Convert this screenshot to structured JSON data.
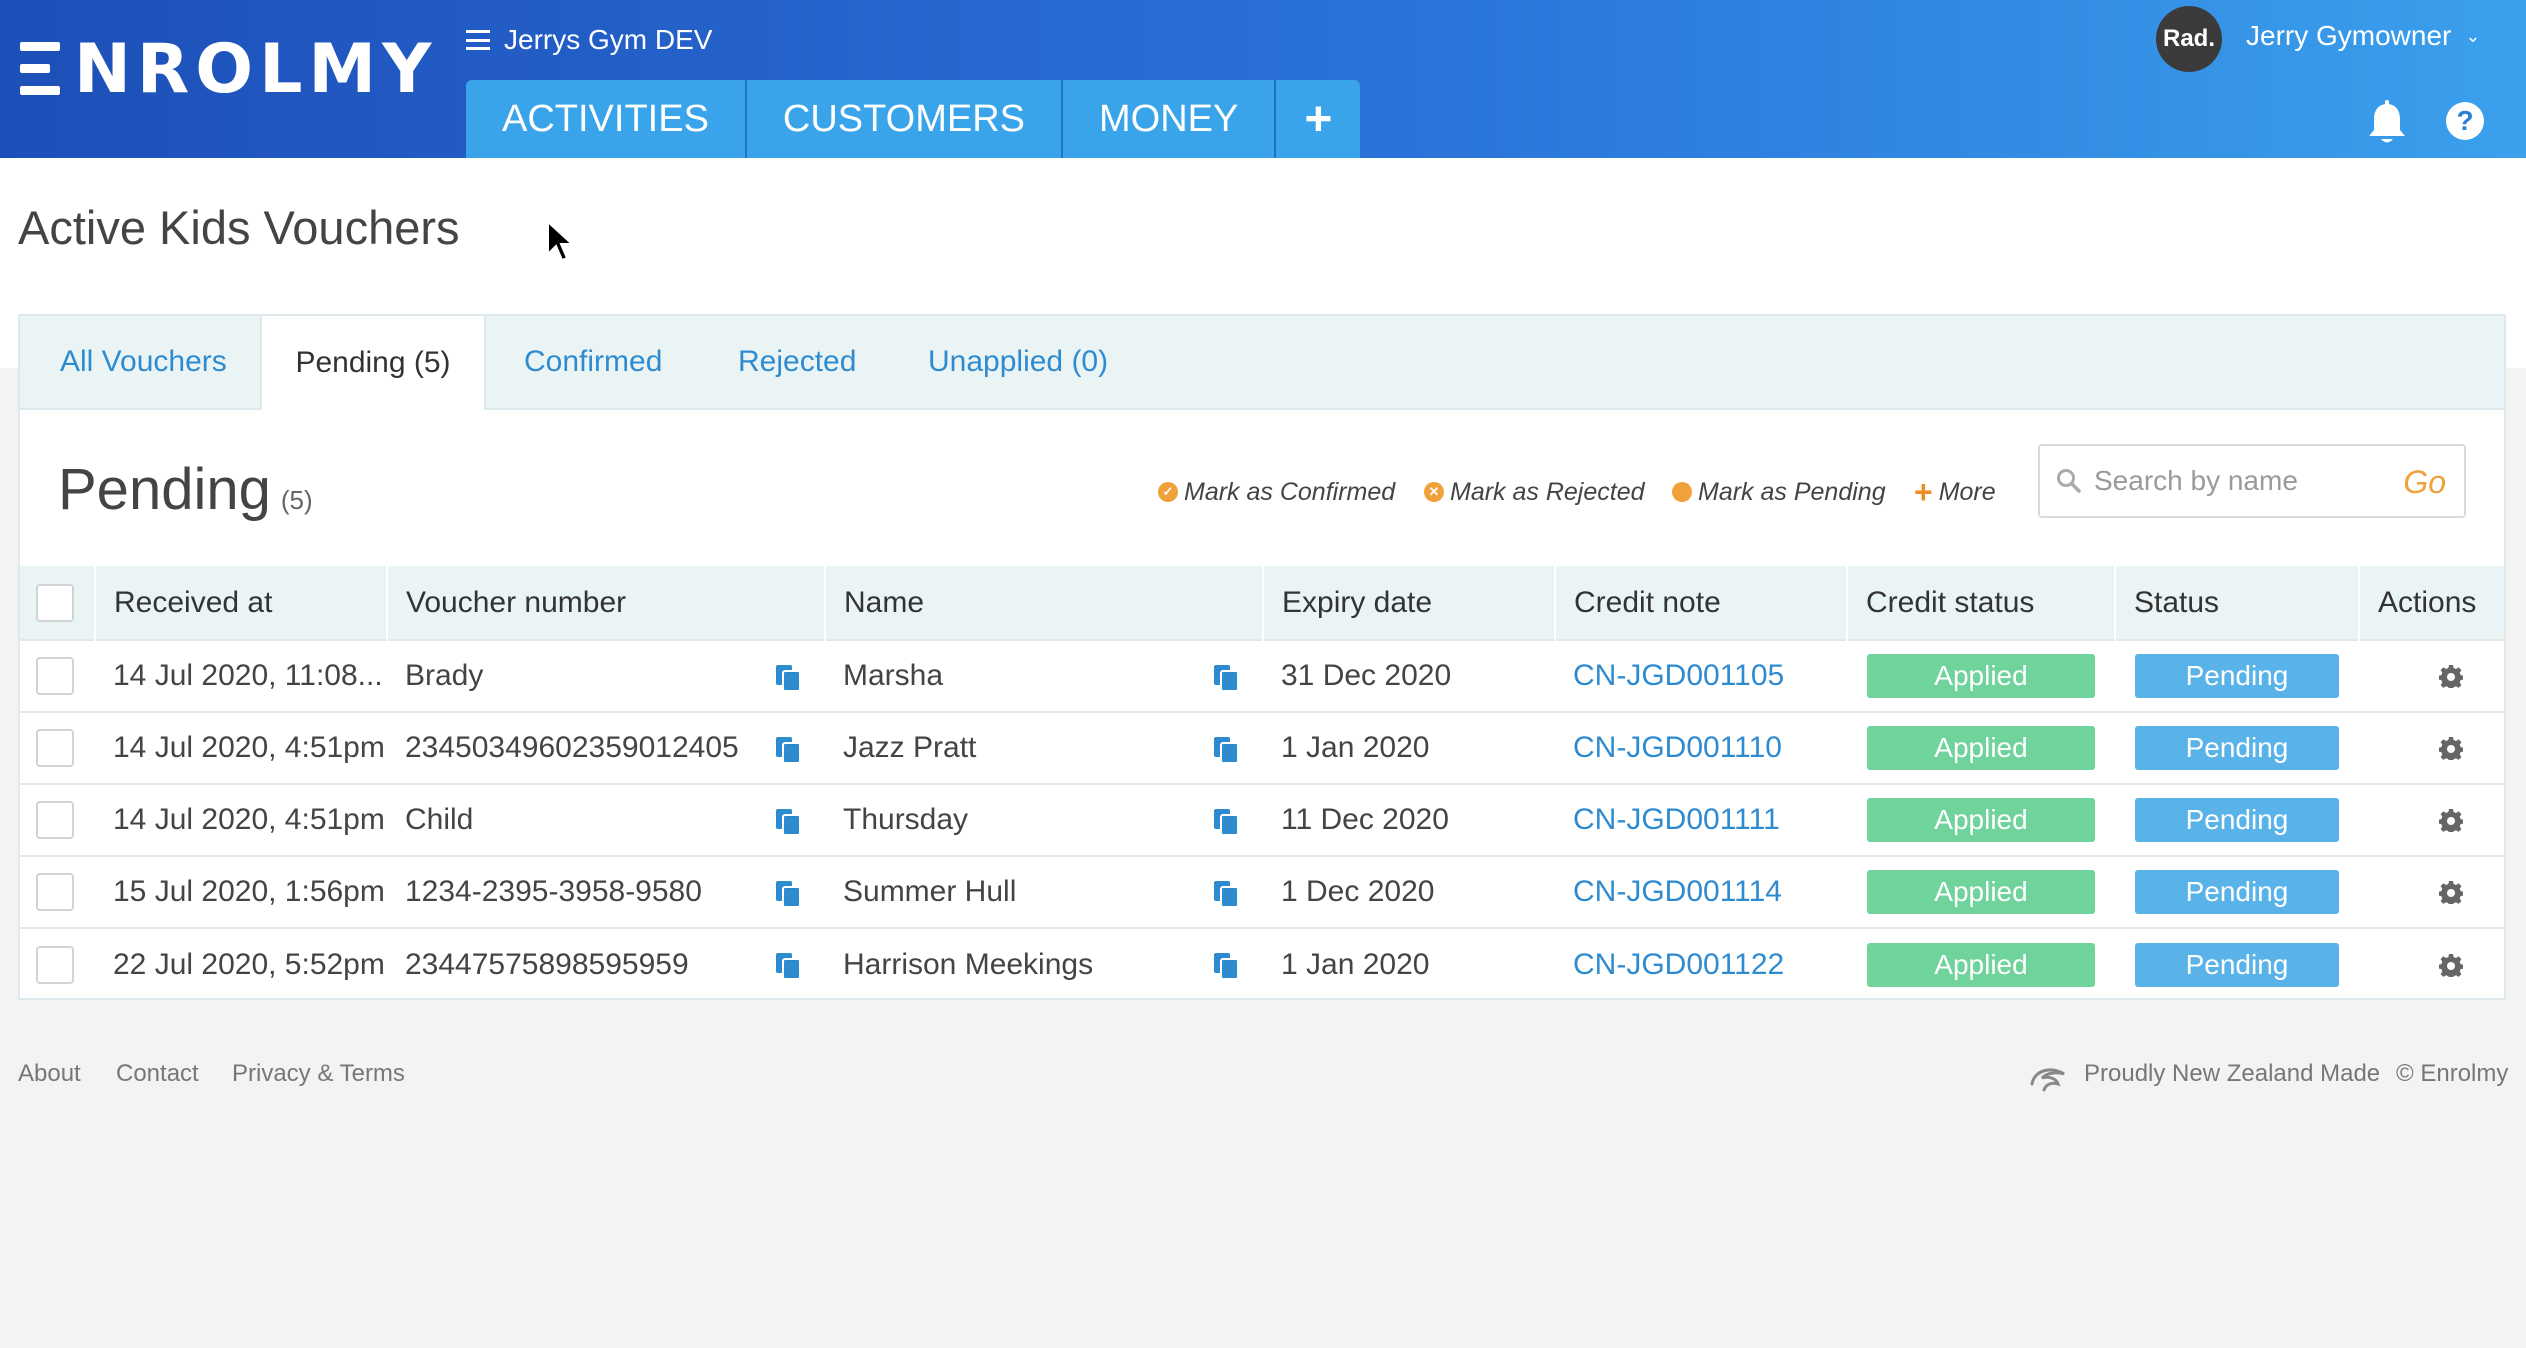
{
  "header": {
    "logo_text": "NROLMY",
    "gym_name": "Jerrys Gym DEV",
    "nav_tabs": [
      "ACTIVITIES",
      "CUSTOMERS",
      "MONEY"
    ],
    "plus_label": "+",
    "avatar_text": "Rad.",
    "user_name": "Jerry Gymowner",
    "help_label": "?"
  },
  "page": {
    "title": "Active Kids Vouchers"
  },
  "tabs": [
    "All Vouchers",
    "Pending (5)",
    "Confirmed",
    "Rejected",
    "Unapplied (0)"
  ],
  "section": {
    "title": "Pending",
    "count": "(5)"
  },
  "actions": {
    "confirm": "Mark as Confirmed",
    "reject": "Mark as Rejected",
    "pending": "Mark as Pending",
    "more": "More"
  },
  "search": {
    "placeholder": "Search by name",
    "go": "Go"
  },
  "table": {
    "headers": [
      "Received at",
      "Voucher number",
      "Name",
      "Expiry date",
      "Credit note",
      "Credit status",
      "Status",
      "Actions"
    ],
    "rows": [
      {
        "received": "14 Jul 2020, 11:08...",
        "voucher": "Brady",
        "name": "Marsha",
        "expiry": "31 Dec 2020",
        "credit_note": "CN-JGD001105",
        "credit_status": "Applied",
        "status": "Pending"
      },
      {
        "received": "14 Jul 2020, 4:51pm",
        "voucher": "23450349602359012405",
        "name": "Jazz Pratt",
        "expiry": "1 Jan 2020",
        "credit_note": "CN-JGD001110",
        "credit_status": "Applied",
        "status": "Pending"
      },
      {
        "received": "14 Jul 2020, 4:51pm",
        "voucher": "Child",
        "name": "Thursday",
        "expiry": "11 Dec 2020",
        "credit_note": "CN-JGD001111",
        "credit_status": "Applied",
        "status": "Pending"
      },
      {
        "received": "15 Jul 2020, 1:56pm",
        "voucher": "1234-2395-3958-9580",
        "name": "Summer Hull",
        "expiry": "1 Dec 2020",
        "credit_note": "CN-JGD001114",
        "credit_status": "Applied",
        "status": "Pending"
      },
      {
        "received": "22 Jul 2020, 5:52pm",
        "voucher": "23447575898595959",
        "name": "Harrison Meekings",
        "expiry": "1 Jan 2020",
        "credit_note": "CN-JGD001122",
        "credit_status": "Applied",
        "status": "Pending"
      }
    ]
  },
  "footer": {
    "about": "About",
    "contact": "Contact",
    "privacy": "Privacy & Terms",
    "nz_made": "Proudly New Zealand Made",
    "copyright": "© Enrolmy"
  },
  "colors": {
    "header_start": "#1d4fb8",
    "header_end": "#3aa0ec",
    "nav_tab": "#3aa4ea",
    "link": "#2f8bd0",
    "applied_badge": "#6fd39b",
    "pending_badge": "#5ab3e8",
    "accent_orange": "#f0a13a"
  }
}
